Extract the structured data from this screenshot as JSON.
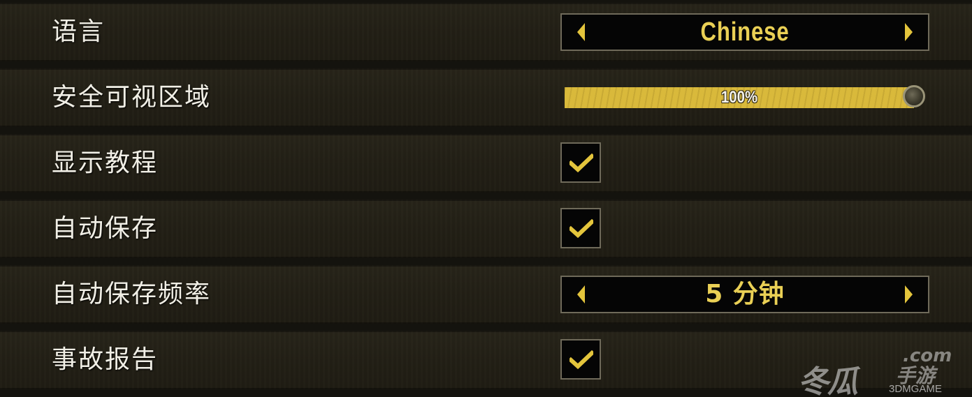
{
  "settings": {
    "language": {
      "label": "语言",
      "value": "Chinese"
    },
    "safe_area": {
      "label": "安全可视区域",
      "value_text": "100%",
      "level": 1.0
    },
    "show_tutorial": {
      "label": "显示教程",
      "checked": true
    },
    "autosave": {
      "label": "自动保存",
      "checked": true
    },
    "autosave_frequency": {
      "label": "自动保存频率",
      "value": "5 分钟"
    },
    "crash_report": {
      "label": "事故报告",
      "checked": true
    }
  },
  "watermark": {
    "brand": "冬瓜",
    "domain": ".com",
    "suffix": "手游",
    "source": "3DMGAME"
  },
  "colors": {
    "accent": "#e4c53c",
    "label": "#f1efe6",
    "row_bg": "#231f16"
  },
  "icons": {
    "arrow_left": "triangle-left",
    "arrow_right": "triangle-right",
    "check": "checkmark",
    "slider_knob": "circle-knob"
  }
}
